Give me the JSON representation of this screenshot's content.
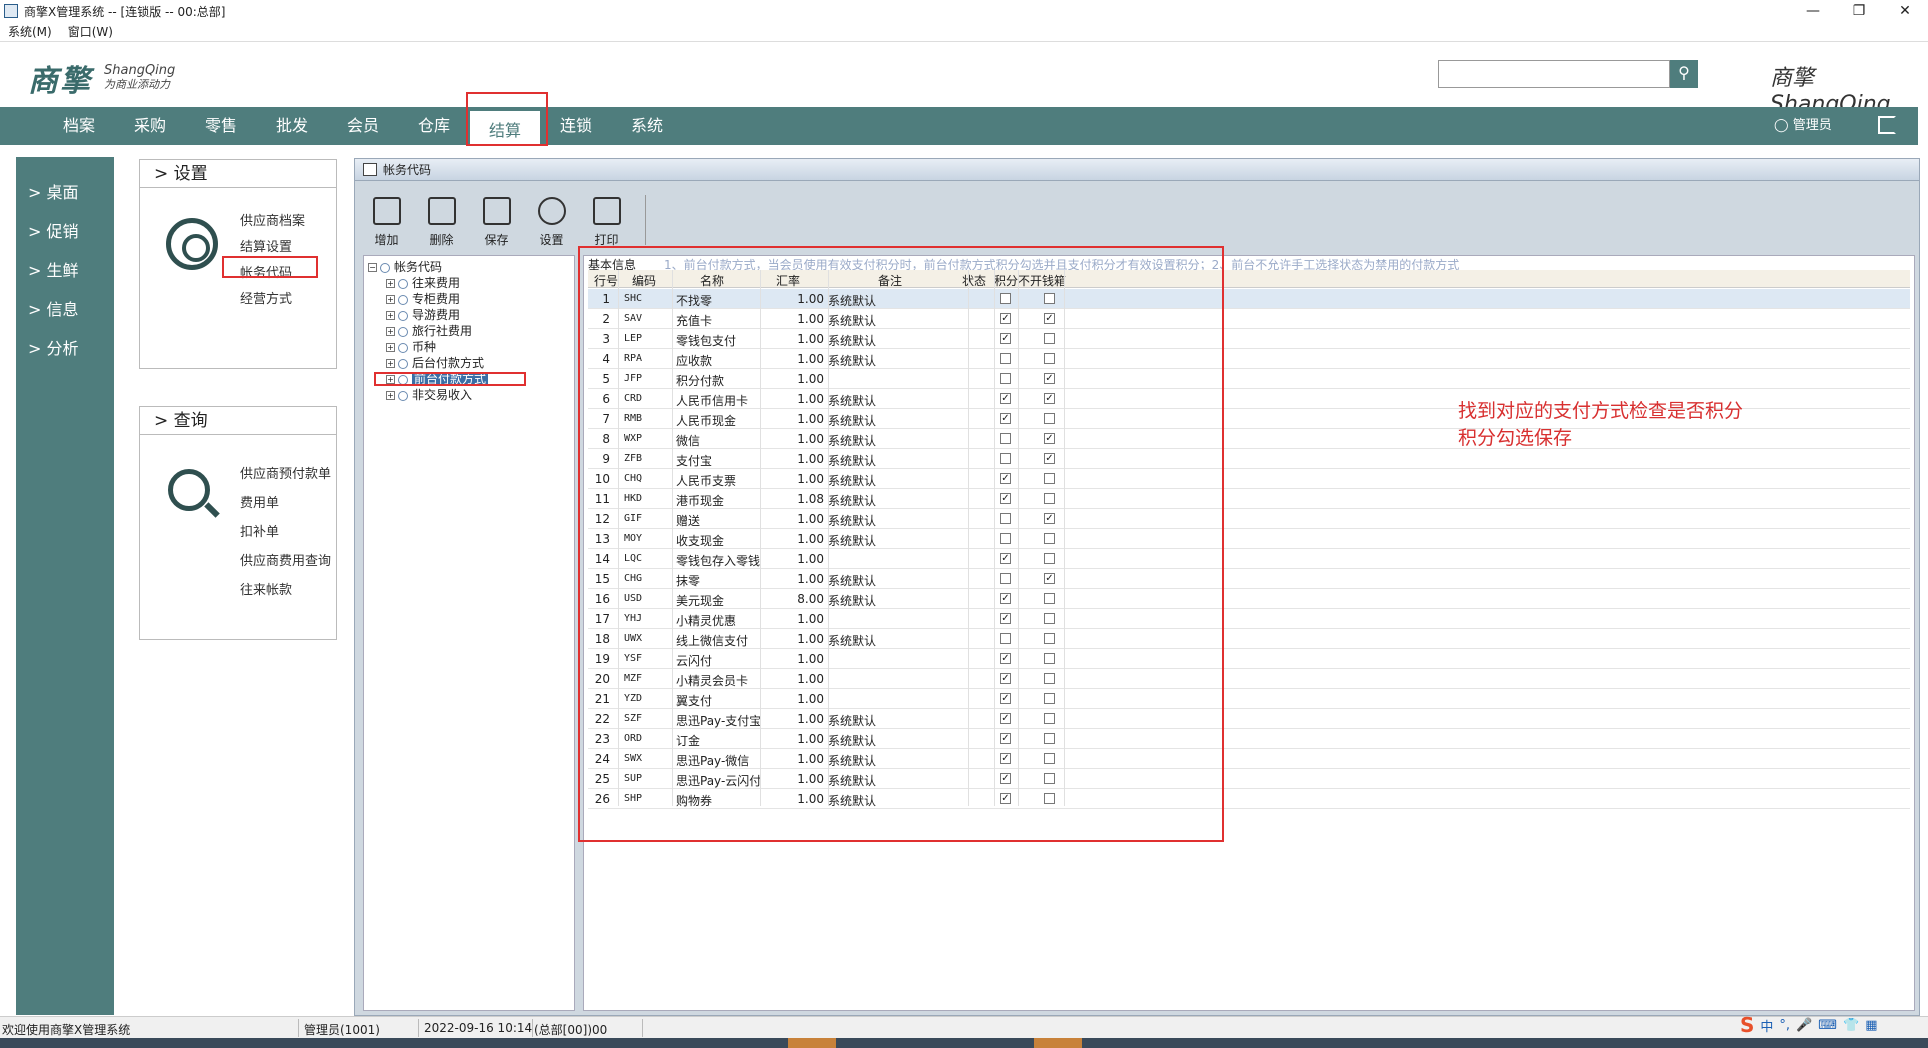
{
  "window": {
    "title": "商擎X管理系统 -- [连锁版 -- 00:总部]",
    "controls": [
      "—",
      "❐",
      "✕"
    ]
  },
  "menubar": [
    "系统(M)",
    "窗口(W)"
  ],
  "header": {
    "logo_cn": "商擎",
    "logo_en": "ShangQing",
    "slogan": "为商业添动力",
    "search_placeholder": "",
    "brand_right": "商擎 ShangQing"
  },
  "nav": {
    "items": [
      "档案",
      "采购",
      "零售",
      "批发",
      "会员",
      "仓库",
      "结算",
      "连锁",
      "系统"
    ],
    "active": "结算",
    "user": "管理员"
  },
  "sidebar": [
    "> 桌面",
    "> 促销",
    "> 生鲜",
    "> 信息",
    "> 分析"
  ],
  "settings_panel": {
    "title": ">  设置",
    "links": [
      "供应商档案",
      "结算设置",
      "帐务代码",
      "经营方式"
    ]
  },
  "query_panel": {
    "title": ">  查询",
    "links": [
      "供应商预付款单",
      "费用单",
      "扣补单",
      "供应商费用查询",
      "往来帐款"
    ]
  },
  "main_window": {
    "title": "帐务代码",
    "toolbar": [
      "增加",
      "删除",
      "保存",
      "设置",
      "打印"
    ],
    "tree": {
      "root": "帐务代码",
      "nodes": [
        "往来费用",
        "专柜费用",
        "导游费用",
        "旅行社费用",
        "币种",
        "后台付款方式",
        "前台付款方式",
        "非交易收入"
      ],
      "selected": "前台付款方式"
    },
    "grid": {
      "section_title": "基本信息",
      "note": "1、前台付款方式，当会员使用有效支付积分时，前台付款方式积分勾选并且支付积分才有效设置积分；2、前台不允许手工选择状态为禁用的付款方式",
      "columns": [
        "行号",
        "编码",
        "名称",
        "汇率",
        "备注",
        "状态",
        "积分",
        "不开钱箱"
      ],
      "rows": [
        {
          "no": "1",
          "code": "SHC",
          "name": "不找零",
          "rate": "1.00",
          "remark": "系统默认",
          "points": false,
          "nodrawer": false
        },
        {
          "no": "2",
          "code": "SAV",
          "name": "充值卡",
          "rate": "1.00",
          "remark": "系统默认",
          "points": true,
          "nodrawer": true
        },
        {
          "no": "3",
          "code": "LEP",
          "name": "零钱包支付",
          "rate": "1.00",
          "remark": "系统默认",
          "points": true,
          "nodrawer": false
        },
        {
          "no": "4",
          "code": "RPA",
          "name": "应收款",
          "rate": "1.00",
          "remark": "系统默认",
          "points": false,
          "nodrawer": false
        },
        {
          "no": "5",
          "code": "JFP",
          "name": "积分付款",
          "rate": "1.00",
          "remark": "",
          "points": false,
          "nodrawer": true
        },
        {
          "no": "6",
          "code": "CRD",
          "name": "人民币信用卡",
          "rate": "1.00",
          "remark": "系统默认",
          "points": true,
          "nodrawer": true
        },
        {
          "no": "7",
          "code": "RMB",
          "name": "人民币现金",
          "rate": "1.00",
          "remark": "系统默认",
          "points": true,
          "nodrawer": false
        },
        {
          "no": "8",
          "code": "WXP",
          "name": "微信",
          "rate": "1.00",
          "remark": "系统默认",
          "points": false,
          "nodrawer": true
        },
        {
          "no": "9",
          "code": "ZFB",
          "name": "支付宝",
          "rate": "1.00",
          "remark": "系统默认",
          "points": false,
          "nodrawer": true
        },
        {
          "no": "10",
          "code": "CHQ",
          "name": "人民币支票",
          "rate": "1.00",
          "remark": "系统默认",
          "points": true,
          "nodrawer": false
        },
        {
          "no": "11",
          "code": "HKD",
          "name": "港币现金",
          "rate": "1.08",
          "remark": "系统默认",
          "points": true,
          "nodrawer": false
        },
        {
          "no": "12",
          "code": "GIF",
          "name": "赠送",
          "rate": "1.00",
          "remark": "系统默认",
          "points": false,
          "nodrawer": true
        },
        {
          "no": "13",
          "code": "MOY",
          "name": "收支现金",
          "rate": "1.00",
          "remark": "系统默认",
          "points": false,
          "nodrawer": false
        },
        {
          "no": "14",
          "code": "LQC",
          "name": "零钱包存入零钱",
          "rate": "1.00",
          "remark": "",
          "points": true,
          "nodrawer": false
        },
        {
          "no": "15",
          "code": "CHG",
          "name": "抹零",
          "rate": "1.00",
          "remark": "系统默认",
          "points": false,
          "nodrawer": true
        },
        {
          "no": "16",
          "code": "USD",
          "name": "美元现金",
          "rate": "8.00",
          "remark": "系统默认",
          "points": true,
          "nodrawer": false
        },
        {
          "no": "17",
          "code": "YHJ",
          "name": "小精灵优惠",
          "rate": "1.00",
          "remark": "",
          "points": true,
          "nodrawer": false
        },
        {
          "no": "18",
          "code": "UWX",
          "name": "线上微信支付",
          "rate": "1.00",
          "remark": "系统默认",
          "points": false,
          "nodrawer": false
        },
        {
          "no": "19",
          "code": "YSF",
          "name": "云闪付",
          "rate": "1.00",
          "remark": "",
          "points": true,
          "nodrawer": false
        },
        {
          "no": "20",
          "code": "MZF",
          "name": "小精灵会员卡",
          "rate": "1.00",
          "remark": "",
          "points": true,
          "nodrawer": false
        },
        {
          "no": "21",
          "code": "YZD",
          "name": "翼支付",
          "rate": "1.00",
          "remark": "",
          "points": true,
          "nodrawer": false
        },
        {
          "no": "22",
          "code": "SZF",
          "name": "思迅Pay-支付宝",
          "rate": "1.00",
          "remark": "系统默认",
          "points": true,
          "nodrawer": false
        },
        {
          "no": "23",
          "code": "ORD",
          "name": "订金",
          "rate": "1.00",
          "remark": "系统默认",
          "points": true,
          "nodrawer": false
        },
        {
          "no": "24",
          "code": "SWX",
          "name": "思迅Pay-微信",
          "rate": "1.00",
          "remark": "系统默认",
          "points": true,
          "nodrawer": false
        },
        {
          "no": "25",
          "code": "SUP",
          "name": "思迅Pay-云闪付",
          "rate": "1.00",
          "remark": "系统默认",
          "points": true,
          "nodrawer": false
        },
        {
          "no": "26",
          "code": "SHP",
          "name": "购物券",
          "rate": "1.00",
          "remark": "系统默认",
          "points": true,
          "nodrawer": false
        }
      ]
    }
  },
  "annotation": [
    "找到对应的支付方式检查是否积分",
    "积分勾选保存"
  ],
  "statusbar": {
    "welcome": "欢迎使用商擎X管理系统",
    "user": "管理员(1001)",
    "datetime": "2022-09-16 10:14",
    "branch": "(总部[00])00"
  },
  "tray": [
    "中",
    "°,",
    "🎤",
    "⌨",
    "👕",
    "▦"
  ],
  "colors": {
    "nav_bg": "#4f7d7d",
    "highlight": "#e03030",
    "annotation": "#d83030"
  }
}
